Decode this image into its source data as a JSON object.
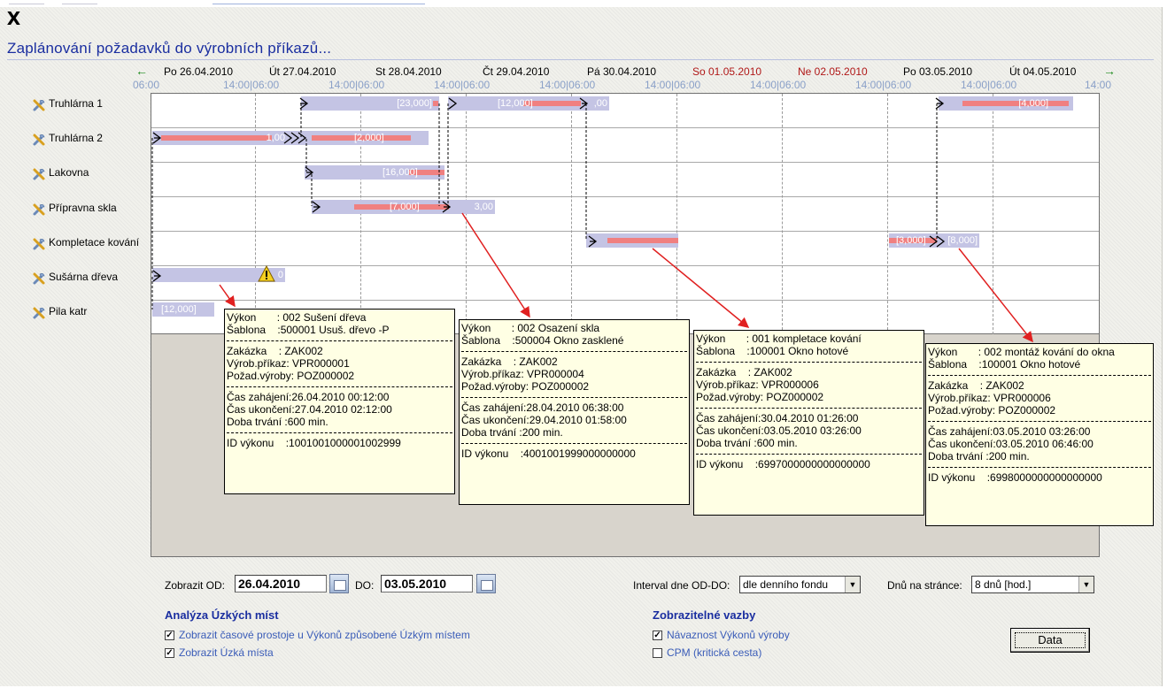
{
  "window": {
    "close_glyph": "X",
    "title": "Zaplánování požadavků do výrobních příkazů..."
  },
  "timeline": {
    "prev_arrow": "←",
    "next_arrow": "→",
    "days": [
      {
        "label": "Po 26.04.2010",
        "weekend": false
      },
      {
        "label": "Út 27.04.2010",
        "weekend": false
      },
      {
        "label": "St 28.04.2010",
        "weekend": false
      },
      {
        "label": "Čt 29.04.2010",
        "weekend": false
      },
      {
        "label": "Pá 30.04.2010",
        "weekend": false
      },
      {
        "label": "So 01.05.2010",
        "weekend": true
      },
      {
        "label": "Ne 02.05.2010",
        "weekend": true
      },
      {
        "label": "Po 03.05.2010",
        "weekend": false
      },
      {
        "label": "Út 04.05.2010",
        "weekend": false
      }
    ],
    "hours": [
      "06:00",
      "14:00|06:00",
      "14:00|06:00",
      "14:00|06:00",
      "14:00|06:00",
      "14:00|06:00",
      "14:00|06:00",
      "14:00|06:00",
      "14:00|06:00",
      "14:00"
    ]
  },
  "resources": [
    {
      "name": "Truhlárna 1"
    },
    {
      "name": "Truhlárna 2"
    },
    {
      "name": "Lakovna"
    },
    {
      "name": "Přípravna skla"
    },
    {
      "name": "Kompletace kování"
    },
    {
      "name": "Sušárna dřeva"
    },
    {
      "name": "Pila katr"
    }
  ],
  "bars": {
    "truhlarna1": [
      "[23,000]",
      "[12,000]",
      ",00",
      "[4,000]"
    ],
    "truhlarna2": [
      "1,00",
      "[2,000]"
    ],
    "lakovna": [
      "[16,000]"
    ],
    "pripravna": [
      "[7,000]",
      "3,00"
    ],
    "kompletace": [
      "[3,000]",
      "[8,000]"
    ],
    "susarna": [
      "0"
    ],
    "pila": [
      "[12,000]"
    ]
  },
  "tooltips": [
    {
      "vykon": "Výkon       : 002 Sušení dřeva",
      "sablona": "Šablona    :500001 Usuš. dřevo -P",
      "zakazka": "Zakázka    : ZAK002",
      "prikaz": "Výrob.příkaz: VPR000001",
      "pozad": "Požad.výroby: POZ000002",
      "zahajeni": "Čas zahájení:26.04.2010 00:12:00",
      "ukonceni": "Čas ukončení:27.04.2010 02:12:00",
      "doba": "Doba trvání :600 min.",
      "id": "ID výkonu    :1001001000001002999"
    },
    {
      "vykon": "Výkon       : 002 Osazení skla",
      "sablona": "Šablona    :500004 Okno zasklené",
      "zakazka": "Zakázka    : ZAK002",
      "prikaz": "Výrob.příkaz: VPR000004",
      "pozad": "Požad.výroby: POZ000002",
      "zahajeni": "Čas zahájení:28.04.2010 06:38:00",
      "ukonceni": "Čas ukončení:29.04.2010 01:58:00",
      "doba": "Doba trvání :200 min.",
      "id": "ID výkonu    :4001001999000000000"
    },
    {
      "vykon": "Výkon       : 001 kompletace kování",
      "sablona": "Šablona    :100001 Okno hotové",
      "zakazka": "Zakázka    : ZAK002",
      "prikaz": "Výrob.příkaz: VPR000006",
      "pozad": "Požad.výroby: POZ000002",
      "zahajeni": "Čas zahájení:30.04.2010 01:26:00",
      "ukonceni": "Čas ukončení:03.05.2010 03:26:00",
      "doba": "Doba trvání :600 min.",
      "id": "ID výkonu    :6997000000000000000"
    },
    {
      "vykon": "Výkon       : 002 montáž kování do okna",
      "sablona": "Šablona    :100001 Okno hotové",
      "zakazka": "Zakázka    : ZAK002",
      "prikaz": "Výrob.příkaz: VPR000006",
      "pozad": "Požad.výroby: POZ000002",
      "zahajeni": "Čas zahájení:03.05.2010 03:26:00",
      "ukonceni": "Čas ukončení:03.05.2010 06:46:00",
      "doba": "Doba trvání :200 min.",
      "id": "ID výkonu    :6998000000000000000"
    }
  ],
  "controls": {
    "od_label": "Zobrazit OD:",
    "od_value": "26.04.2010",
    "do_label": "DO:",
    "do_value": "03.05.2010",
    "interval_label": "Interval dne OD-DO:",
    "interval_value": "dle denního fondu",
    "days_label": "Dnů na stránce:",
    "days_value": "8 dnů [hod.]",
    "analysis_title": "Analýza Úzkých míst",
    "analysis_opt1": "Zobrazit časové prostoje u Výkonů způsobené Úzkým místem",
    "analysis_opt1_checked": true,
    "analysis_opt2": "Zobrazit Úzká místa",
    "analysis_opt2_checked": true,
    "links_title": "Zobrazitelné vazby",
    "links_opt1": "Návaznost Výkonů výroby",
    "links_opt1_checked": true,
    "links_opt2": "CPM (kritická cesta)",
    "links_opt2_checked": false,
    "data_button": "Data"
  },
  "colors": {
    "title": "#1a2ea0",
    "weekend": "#b01818",
    "bar": "#c4c4e4",
    "bar_load": "#f08080",
    "tooltip_bg": "#ffffe4",
    "connector": "#e02020",
    "nav_arrow": "#1b8a1b"
  },
  "icons": {
    "resource": "tools-icon",
    "calendar": "calendar-icon",
    "warning": "warning-icon",
    "link": "arrow-link-icon"
  }
}
